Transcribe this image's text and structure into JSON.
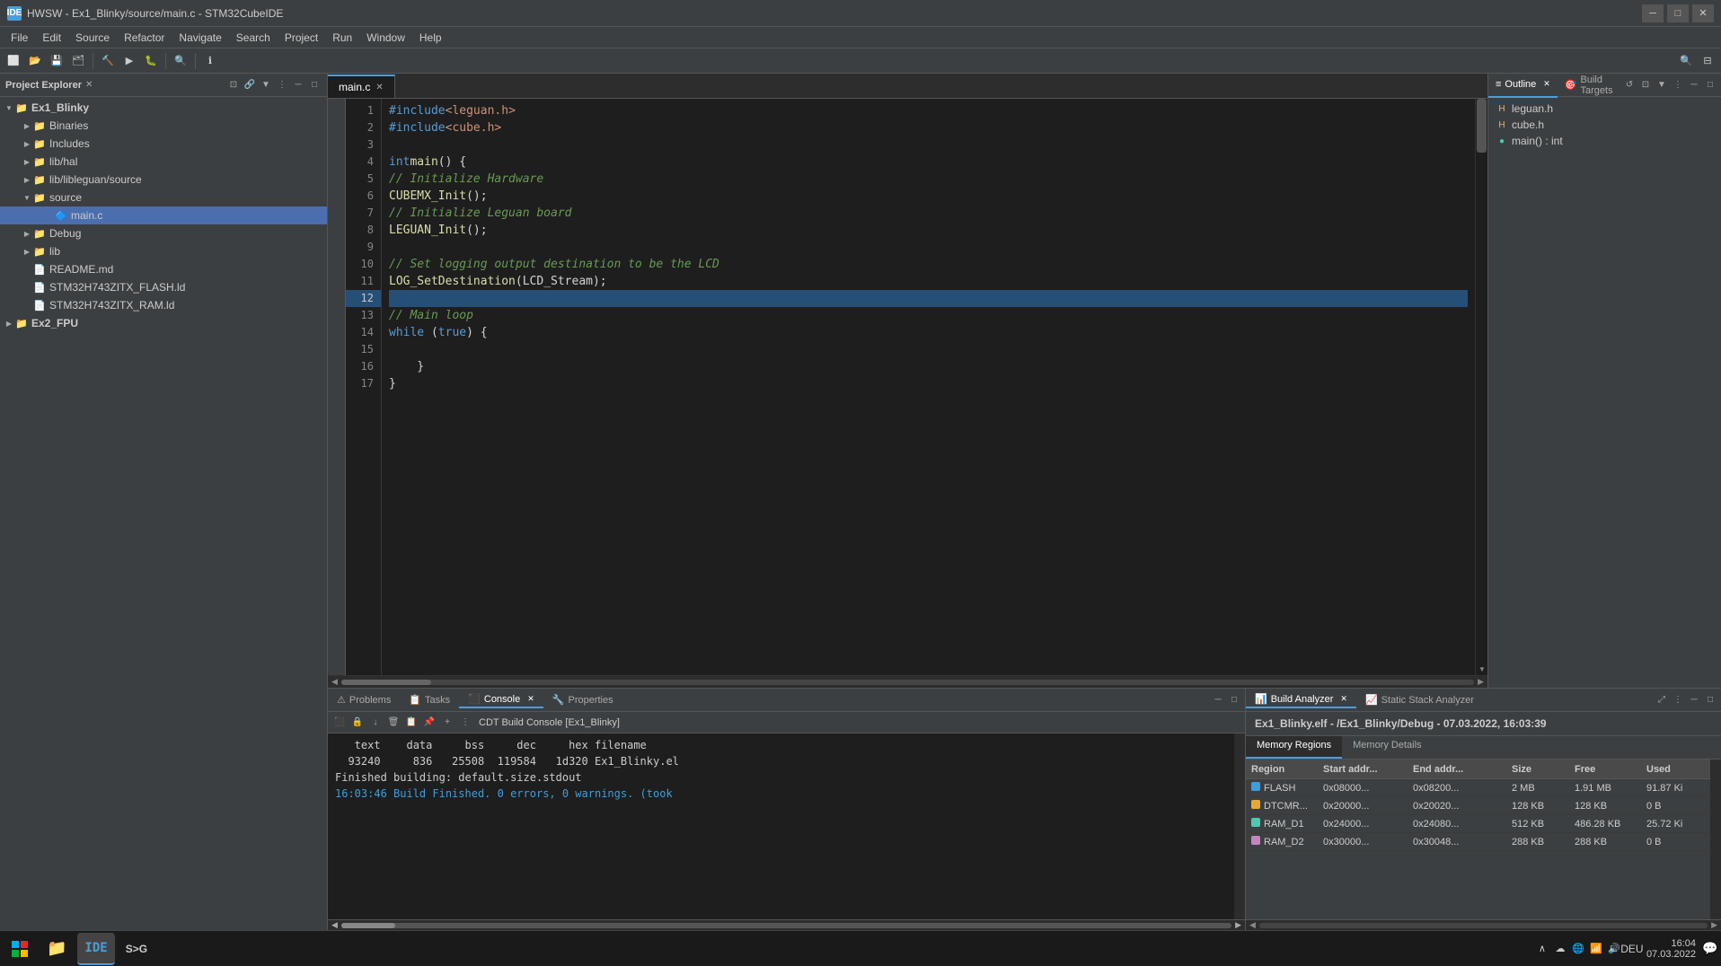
{
  "titlebar": {
    "icon": "IDE",
    "title": "HWSW - Ex1_Blinky/source/main.c - STM32CubeIDE"
  },
  "menubar": {
    "items": [
      "File",
      "Edit",
      "Source",
      "Refactor",
      "Navigate",
      "Search",
      "Project",
      "Run",
      "Window",
      "Help"
    ]
  },
  "sidebar": {
    "title": "Project Explorer",
    "tree": [
      {
        "id": "ex1_blinky",
        "label": "Ex1_Blinky",
        "level": 0,
        "type": "project",
        "expanded": true
      },
      {
        "id": "binaries",
        "label": "Binaries",
        "level": 1,
        "type": "folder",
        "expanded": false
      },
      {
        "id": "includes",
        "label": "Includes",
        "level": 1,
        "type": "folder",
        "expanded": false
      },
      {
        "id": "libhal",
        "label": "lib/hal",
        "level": 1,
        "type": "folder",
        "expanded": false
      },
      {
        "id": "liblibleguan",
        "label": "lib/libleguan/source",
        "level": 1,
        "type": "folder",
        "expanded": false
      },
      {
        "id": "source",
        "label": "source",
        "level": 1,
        "type": "folder",
        "expanded": true
      },
      {
        "id": "main_c",
        "label": "main.c",
        "level": 2,
        "type": "file_c",
        "expanded": false,
        "selected": true
      },
      {
        "id": "debug",
        "label": "Debug",
        "level": 1,
        "type": "folder",
        "expanded": false
      },
      {
        "id": "lib",
        "label": "lib",
        "level": 1,
        "type": "folder",
        "expanded": false
      },
      {
        "id": "readme",
        "label": "README.md",
        "level": 1,
        "type": "file",
        "expanded": false
      },
      {
        "id": "flash_ld",
        "label": "STM32H743ZITX_FLASH.ld",
        "level": 1,
        "type": "file",
        "expanded": false
      },
      {
        "id": "ram_ld",
        "label": "STM32H743ZITX_RAM.ld",
        "level": 1,
        "type": "file",
        "expanded": false
      },
      {
        "id": "ex2_fpu",
        "label": "Ex2_FPU",
        "level": 0,
        "type": "project",
        "expanded": false
      }
    ]
  },
  "editor": {
    "tab_label": "main.c",
    "lines": [
      {
        "num": 1,
        "text": "#include <leguan.h>",
        "tokens": [
          {
            "type": "kw",
            "text": "#include"
          },
          {
            "type": "space",
            "text": " "
          },
          {
            "type": "include",
            "text": "<leguan.h>"
          }
        ]
      },
      {
        "num": 2,
        "text": "#include <cube.h>",
        "tokens": [
          {
            "type": "kw",
            "text": "#include"
          },
          {
            "type": "space",
            "text": " "
          },
          {
            "type": "include",
            "text": "<cube.h>"
          }
        ]
      },
      {
        "num": 3,
        "text": ""
      },
      {
        "num": 4,
        "text": "int main() {",
        "tokens": [
          {
            "type": "kw",
            "text": "int"
          },
          {
            "type": "space",
            "text": " "
          },
          {
            "type": "fn",
            "text": "main"
          },
          {
            "type": "plain",
            "text": "() {"
          }
        ]
      },
      {
        "num": 5,
        "text": "    // Initialize Hardware",
        "tokens": [
          {
            "type": "space",
            "text": "    "
          },
          {
            "type": "comment",
            "text": "// Initialize Hardware"
          }
        ]
      },
      {
        "num": 6,
        "text": "    CUBEMX_Init();",
        "tokens": [
          {
            "type": "space",
            "text": "    "
          },
          {
            "type": "fn",
            "text": "CUBEMX_Init"
          },
          {
            "type": "plain",
            "text": "();"
          }
        ]
      },
      {
        "num": 7,
        "text": "    // Initialize Leguan board",
        "tokens": [
          {
            "type": "space",
            "text": "    "
          },
          {
            "type": "comment",
            "text": "// Initialize Leguan board"
          }
        ]
      },
      {
        "num": 8,
        "text": "    LEGUAN_Init();",
        "tokens": [
          {
            "type": "space",
            "text": "    "
          },
          {
            "type": "fn",
            "text": "LEGUAN_Init"
          },
          {
            "type": "plain",
            "text": "();"
          }
        ]
      },
      {
        "num": 9,
        "text": ""
      },
      {
        "num": 10,
        "text": "    // Set logging output destination to be the LCD",
        "tokens": [
          {
            "type": "space",
            "text": "    "
          },
          {
            "type": "comment",
            "text": "// Set logging output destination to be the LCD"
          }
        ]
      },
      {
        "num": 11,
        "text": "    LOG_SetDestination(LCD_Stream);",
        "tokens": [
          {
            "type": "space",
            "text": "    "
          },
          {
            "type": "fn",
            "text": "LOG_SetDestination"
          },
          {
            "type": "plain",
            "text": "(LCD_Stream);"
          }
        ]
      },
      {
        "num": 12,
        "text": "",
        "highlighted": true
      },
      {
        "num": 13,
        "text": "    // Main loop",
        "tokens": [
          {
            "type": "space",
            "text": "    "
          },
          {
            "type": "comment",
            "text": "// Main loop"
          }
        ]
      },
      {
        "num": 14,
        "text": "    while (true) {",
        "tokens": [
          {
            "type": "space",
            "text": "    "
          },
          {
            "type": "kw",
            "text": "while"
          },
          {
            "type": "plain",
            "text": " ("
          },
          {
            "type": "kw",
            "text": "true"
          },
          {
            "type": "plain",
            "text": ") {"
          }
        ]
      },
      {
        "num": 15,
        "text": ""
      },
      {
        "num": 16,
        "text": "    }",
        "tokens": [
          {
            "type": "space",
            "text": "    "
          },
          {
            "type": "plain",
            "text": "}"
          }
        ]
      },
      {
        "num": 17,
        "text": "}",
        "tokens": [
          {
            "type": "plain",
            "text": "}"
          }
        ]
      }
    ]
  },
  "outline": {
    "panel_title": "Outline",
    "build_targets_title": "Build Targets",
    "items": [
      {
        "label": "leguan.h",
        "icon": "h-file"
      },
      {
        "label": "cube.h",
        "icon": "h-file"
      },
      {
        "label": "main() : int",
        "icon": "fn",
        "active": true
      }
    ]
  },
  "console_panel": {
    "tabs": [
      "Problems",
      "Tasks",
      "Console",
      "Properties"
    ],
    "active_tab": "Console",
    "toolbar_title": "CDT Build Console [Ex1_Blinky]",
    "output_lines": [
      {
        "text": "   text    data     bss     dec     hex filename",
        "type": "normal"
      },
      {
        "text": "  93240     836   25508  119584   1d320 Ex1_Blinky.el",
        "type": "normal"
      },
      {
        "text": "Finished building: default.size.stdout",
        "type": "normal"
      },
      {
        "text": "",
        "type": "normal"
      },
      {
        "text": "16:03:46 Build Finished. 0 errors, 0 warnings. (took",
        "type": "build-done"
      }
    ]
  },
  "build_analyzer": {
    "tabs": [
      "Build Analyzer",
      "Static Stack Analyzer"
    ],
    "active_tab": "Build Analyzer",
    "header": "Ex1_Blinky.elf - /Ex1_Blinky/Debug - 07.03.2022, 16:03:39",
    "subtabs": [
      "Memory Regions",
      "Memory Details"
    ],
    "active_subtab": "Memory Regions",
    "table": {
      "headers": [
        "Region",
        "Start addr...",
        "End addr...",
        "Size",
        "Free",
        "Used"
      ],
      "rows": [
        {
          "region": "FLASH",
          "icon_color": "#3c9edd",
          "start": "0x08000...",
          "end": "0x08200...",
          "size": "2 MB",
          "free": "1.91 MB",
          "used": "91.87 Ki"
        },
        {
          "region": "DTCMR...",
          "icon_color": "#e8a838",
          "start": "0x20000...",
          "end": "0x20020...",
          "size": "128 KB",
          "free": "128 KB",
          "used": "0 B"
        },
        {
          "region": "RAM_D1",
          "icon_color": "#4ec9b0",
          "start": "0x24000...",
          "end": "0x24080...",
          "size": "512 KB",
          "free": "486.28 KB",
          "used": "25.72 Ki"
        },
        {
          "region": "RAM_D2",
          "icon_color": "#c586c0",
          "start": "0x30000...",
          "end": "0x30048...",
          "size": "288 KB",
          "free": "288 KB",
          "used": "0 B"
        }
      ]
    }
  },
  "status_bar": {
    "lang": "DEU",
    "time": "16:04",
    "date": "07.03.2022"
  },
  "taskbar": {
    "apps": [
      {
        "label": "Start",
        "icon": "⊞"
      },
      {
        "label": "Explorer",
        "icon": "📁"
      },
      {
        "label": "IDE",
        "icon": "IDE",
        "active": true
      },
      {
        "label": "S>G",
        "icon": "S>G"
      }
    ]
  }
}
